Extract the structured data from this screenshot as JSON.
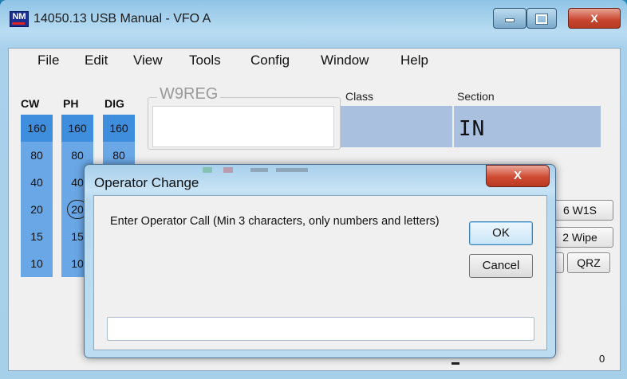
{
  "window": {
    "title": "14050.13 USB Manual - VFO A",
    "icon_text": "NM",
    "close_glyph": "X"
  },
  "menu": [
    "File",
    "Edit",
    "View",
    "Tools",
    "Config",
    "Window",
    "Help"
  ],
  "bands": {
    "headers": [
      "CW",
      "PH",
      "DIG"
    ],
    "cw": [
      "160",
      "80",
      "40",
      "20",
      "15",
      "10"
    ],
    "ph": [
      "160",
      "80",
      "40",
      "20",
      "15",
      "10"
    ],
    "dig": [
      "160",
      "80"
    ],
    "selected_color": "#3f8ede",
    "column_color": "#6aa7e6"
  },
  "entry": {
    "call_label": "W9REG",
    "class_label": "Class",
    "section_label": "Section",
    "section_value": "IN"
  },
  "side_buttons": [
    "6 W1S",
    "2 Wipe",
    "QRZ"
  ],
  "status": {
    "count": "0"
  },
  "dialog": {
    "title": "Operator Change",
    "close_glyph": "X",
    "message": "Enter Operator Call (Min 3 characters, only numbers and letters)",
    "ok_label": "OK",
    "cancel_label": "Cancel",
    "input_value": ""
  }
}
